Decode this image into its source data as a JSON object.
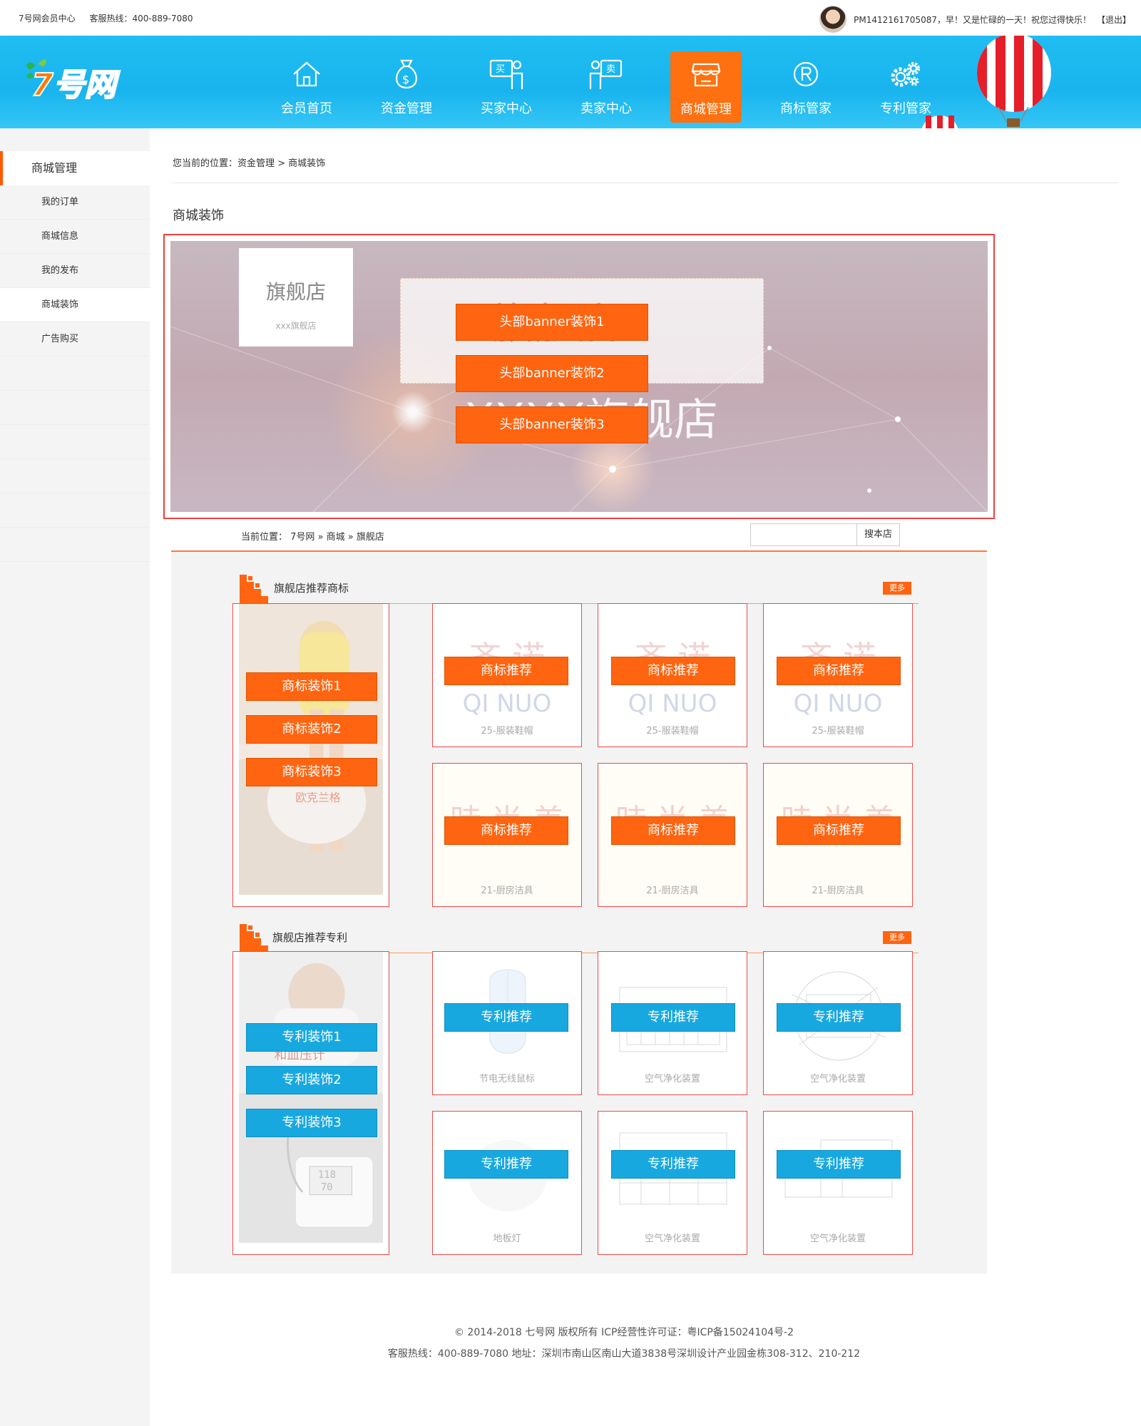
{
  "topbar": {
    "member_center": "7号网会员中心",
    "hotline": "客服热线：400-889-7080",
    "greeting": "PM1412161705087，早！又是忙碌的一天！祝您过得快乐！",
    "logout": "【退出】"
  },
  "logo": {
    "text": "7号网"
  },
  "nav": {
    "items": [
      {
        "label": "会员首页",
        "icon": "home-icon"
      },
      {
        "label": "资金管理",
        "icon": "money-bag-icon"
      },
      {
        "label": "买家中心",
        "icon": "buyer-icon"
      },
      {
        "label": "卖家中心",
        "icon": "seller-icon"
      },
      {
        "label": "商城管理",
        "icon": "store-icon",
        "active": true
      },
      {
        "label": "商标管家",
        "icon": "registered-icon"
      },
      {
        "label": "专利管家",
        "icon": "gears-icon"
      }
    ]
  },
  "sidebar": {
    "heading": "商城管理",
    "items": [
      {
        "label": "我的订单"
      },
      {
        "label": "商城信息"
      },
      {
        "label": "我的发布"
      },
      {
        "label": "商城装饰",
        "active": true
      },
      {
        "label": "广告购买"
      }
    ]
  },
  "breadcrumb": "您当前的位置：资金管理 > 商城装饰",
  "page_title": "商城装饰",
  "banner": {
    "card_title": "旗舰店",
    "card_sub": "xxx旗舰店",
    "ghost_title": "旗舰店",
    "ghost_sub": "XXXX旗舰店",
    "buttons": [
      "头部banner装饰1",
      "头部banner装饰2",
      "头部banner装饰3"
    ]
  },
  "shop": {
    "location": "当前位置： 7号网 » 商城 » 旗舰店",
    "search_button": "搜本店",
    "search_placeholder": "",
    "more_label": "更多",
    "trademark": {
      "title": "旗舰店推荐商标",
      "side_buttons": [
        "商标装饰1",
        "商标装饰2",
        "商标装饰3"
      ],
      "cell_button": "商标推荐",
      "cells": [
        {
          "ghost": "齐 诺",
          "ghost2": "QI NUO",
          "caption": "25-服装鞋帽"
        },
        {
          "ghost": "齐 诺",
          "ghost2": "QI NUO",
          "caption": "25-服装鞋帽"
        },
        {
          "ghost": "齐 诺",
          "ghost2": "QI NUO",
          "caption": "25-服装鞋帽"
        },
        {
          "ghost": "時 尚 美",
          "ghost2": "",
          "caption": "21-厨房洁具"
        },
        {
          "ghost": "時 尚 美",
          "ghost2": "",
          "caption": "21-厨房洁具"
        },
        {
          "ghost": "時 尚 美",
          "ghost2": "",
          "caption": "21-厨房洁具"
        }
      ],
      "side_ghost": "欧克兰格"
    },
    "patent": {
      "title": "旗舰店推荐专利",
      "side_buttons": [
        "专利装饰1",
        "专利装饰2",
        "专利装饰3"
      ],
      "cell_button": "专利推荐",
      "cells": [
        {
          "caption": "节电无线鼠标"
        },
        {
          "caption": "空气净化装置"
        },
        {
          "caption": "空气净化装置"
        },
        {
          "caption": "地板灯"
        },
        {
          "caption": "空气净化装置"
        },
        {
          "caption": "空气净化装置"
        }
      ],
      "side_ghost": "和血压计",
      "bp_top": "118",
      "bp_bottom": "70"
    }
  },
  "footer": {
    "line1": "© 2014-2018 七号网 版权所有 ICP经营性许可证：粤ICP备15024104号-2",
    "line2": "客服热线：400-889-7080  地址：深圳市南山区南山大道3838号深圳设计产业园金栋308-312、210-212"
  },
  "colors": {
    "accent": "#ff6410",
    "nav_bg": "#1fbdf2",
    "patent_btn": "#18a8e0",
    "frame_red": "#f04a4a"
  }
}
